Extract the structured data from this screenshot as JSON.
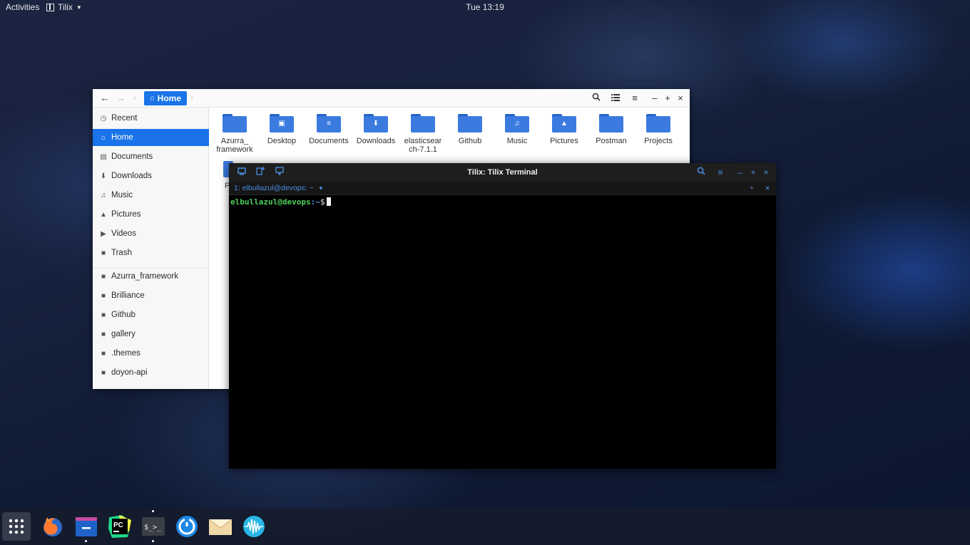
{
  "topbar": {
    "activities": "Activities",
    "app_name": "Tilix",
    "clock": "Tue 13:19"
  },
  "files": {
    "path": "Home",
    "sidebar": [
      {
        "label": "Recent",
        "icon": "clock-icon"
      },
      {
        "label": "Home",
        "icon": "home-icon",
        "active": true
      },
      {
        "label": "Documents",
        "icon": "document-icon"
      },
      {
        "label": "Downloads",
        "icon": "download-icon"
      },
      {
        "label": "Music",
        "icon": "headphones-icon"
      },
      {
        "label": "Pictures",
        "icon": "picture-icon"
      },
      {
        "label": "Videos",
        "icon": "video-icon"
      },
      {
        "label": "Trash",
        "icon": "trash-icon"
      }
    ],
    "bookmarks": [
      {
        "label": "Azurra_framework",
        "icon": "folder-icon"
      },
      {
        "label": "Brilliance",
        "icon": "folder-icon"
      },
      {
        "label": "Github",
        "icon": "folder-icon"
      },
      {
        "label": "gallery",
        "icon": "folder-icon"
      },
      {
        "label": ".themes",
        "icon": "folder-icon"
      },
      {
        "label": "doyon-api",
        "icon": "folder-icon"
      }
    ],
    "folders": [
      {
        "line1": "Azurra_",
        "line2": "framework",
        "emblem": ""
      },
      {
        "line1": "Desktop",
        "line2": "",
        "emblem": "▣"
      },
      {
        "line1": "Documents",
        "line2": "",
        "emblem": "≡"
      },
      {
        "line1": "Downloads",
        "line2": "",
        "emblem": "⬇"
      },
      {
        "line1": "elasticsear",
        "line2": "ch-7.1.1",
        "emblem": ""
      },
      {
        "line1": "Github",
        "line2": "",
        "emblem": ""
      },
      {
        "line1": "Music",
        "line2": "",
        "emblem": "♫"
      },
      {
        "line1": "Pictures",
        "line2": "",
        "emblem": "▲"
      },
      {
        "line1": "Postman",
        "line2": "",
        "emblem": ""
      },
      {
        "line1": "Projects",
        "line2": "",
        "emblem": ""
      }
    ],
    "partial_label": "P"
  },
  "terminal": {
    "title": "Tilix: Tilix Terminal",
    "tab_label": "1: elbullazul@devops: ~",
    "prompt_user": "elbullazul@devops",
    "prompt_path": ":~",
    "prompt_symbol": "$"
  },
  "dock": [
    {
      "name": "show-applications-icon"
    },
    {
      "name": "firefox-icon"
    },
    {
      "name": "files-icon"
    },
    {
      "name": "pycharm-icon",
      "label": "PC"
    },
    {
      "name": "terminal-icon",
      "label": "$_>_"
    },
    {
      "name": "timeshift-icon"
    },
    {
      "name": "mail-icon"
    },
    {
      "name": "audio-icon"
    }
  ]
}
